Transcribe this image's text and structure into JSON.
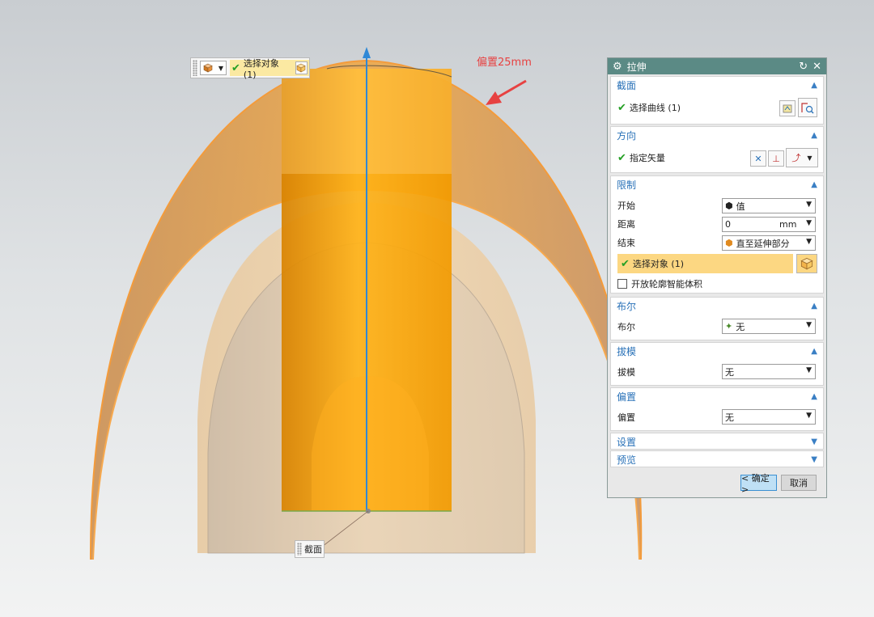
{
  "viewport": {
    "annotation": "偏置25mm",
    "section_tag": "截面",
    "colors": {
      "orange": "#f5a623",
      "axis": "#2f88d6",
      "annotation": "#e74242"
    }
  },
  "selection_bar": {
    "filter_icon": "cube-filter-icon",
    "label": "选择对象 (1)"
  },
  "dialog": {
    "title": "拉伸",
    "groups": {
      "section": {
        "title": "截面",
        "select_curve": "选择曲线 (1)"
      },
      "direction": {
        "title": "方向",
        "specify_vector": "指定矢量"
      },
      "limits": {
        "title": "限制",
        "start_label": "开始",
        "start_value": "值",
        "distance_label": "距离",
        "distance_value": "0",
        "distance_unit": "mm",
        "end_label": "结束",
        "end_value": "直至延伸部分",
        "select_object": "选择对象 (1)",
        "open_profile": "开放轮廓智能体积"
      },
      "boolean": {
        "title": "布尔",
        "label": "布尔",
        "value": "无"
      },
      "draft": {
        "title": "拔模",
        "label": "拔模",
        "value": "无"
      },
      "offset": {
        "title": "偏置",
        "label": "偏置",
        "value": "无"
      },
      "settings": {
        "title": "设置"
      },
      "preview": {
        "title": "预览"
      }
    },
    "ok": "< 确定 >",
    "cancel": "取消"
  }
}
